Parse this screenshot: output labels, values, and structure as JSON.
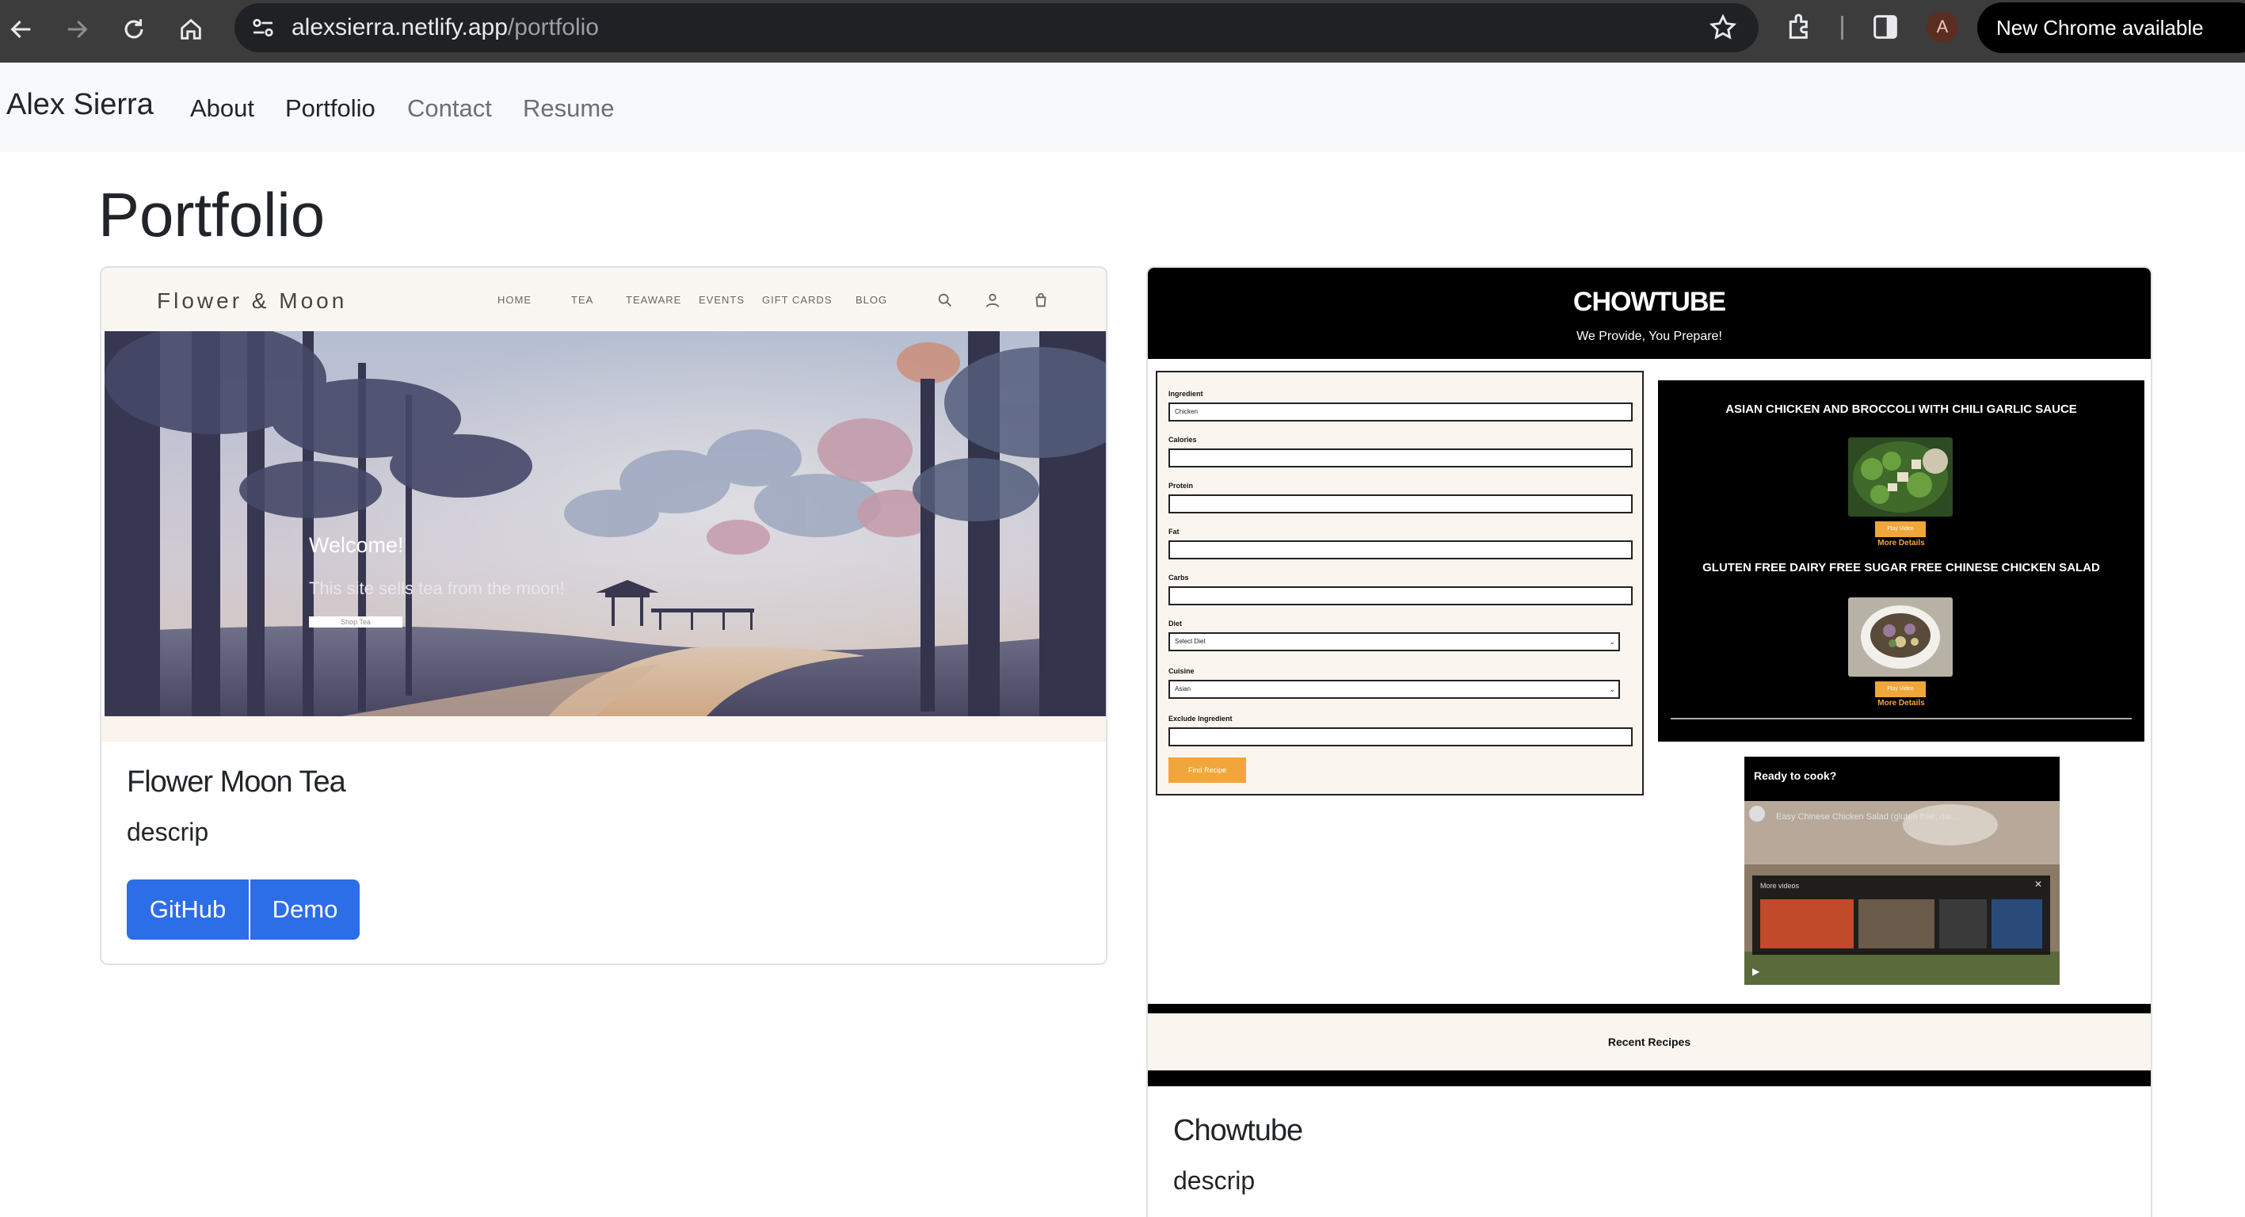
{
  "browser": {
    "url_host": "alexsierra.netlify.app",
    "url_path": "/portfolio",
    "profile_initial": "A",
    "update_label": "New Chrome available"
  },
  "navbar": {
    "brand": "Alex Sierra",
    "links": [
      "About",
      "Portfolio",
      "Contact",
      "Resume"
    ]
  },
  "page": {
    "title": "Portfolio"
  },
  "projects": [
    {
      "title": "Flower Moon Tea",
      "description": "descrip",
      "buttons": [
        "GitHub",
        "Demo"
      ],
      "preview": {
        "logo": "Flower & Moon",
        "nav": [
          "HOME",
          "TEA",
          "TEAWARE",
          "EVENTS",
          "GIFT CARDS",
          "BLOG"
        ],
        "welcome": "Welcome!",
        "tagline": "This site sells tea from the moon!",
        "cta": "Shop Tea"
      }
    },
    {
      "title": "Chowtube",
      "description": "descrip",
      "preview": {
        "logo": "CHOWTUBE",
        "tagline": "We Provide, You Prepare!",
        "form_labels": [
          "Ingredient",
          "Calories",
          "Protein",
          "Fat",
          "Carbs",
          "Diet",
          "Cuisine",
          "Exclude Ingredient"
        ],
        "ingredient_value": "Chicken",
        "diet_value": "Select Diet",
        "cuisine_value": "Asian",
        "find_button": "Find Recipe",
        "results": [
          {
            "title": "ASIAN CHICKEN AND BROCCOLI WITH CHILI GARLIC SAUCE",
            "play": "Play Video",
            "more": "More Details"
          },
          {
            "title": "GLUTEN FREE DAIRY FREE SUGAR FREE CHINESE CHICKEN SALAD",
            "play": "Play Video",
            "more": "More Details"
          }
        ],
        "video_heading": "Ready to cook?",
        "video_title": "Easy Chinese Chicken Salad (gluten free, dai...",
        "more_videos": "More videos",
        "recent": "Recent Recipes"
      }
    }
  ],
  "colors": {
    "primary": "#2c6de8",
    "chowtube_accent": "#f0a63a",
    "navbar_bg": "#f8f9fa",
    "chrome_bg": "#3c3c3c"
  }
}
